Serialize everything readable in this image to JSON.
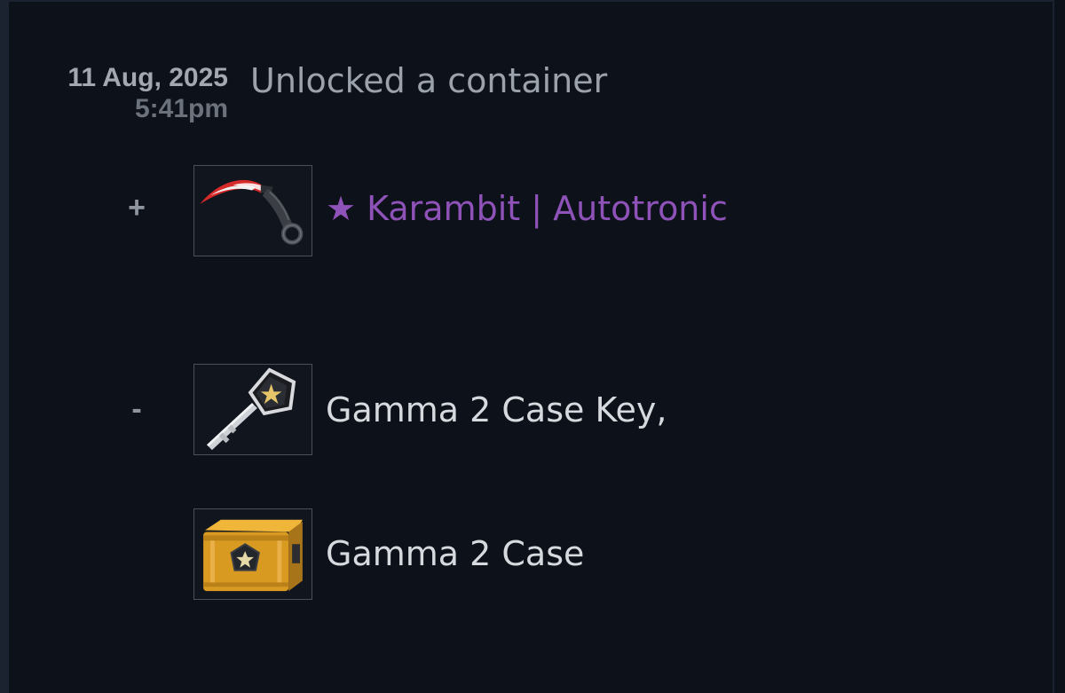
{
  "event": {
    "date": "11 Aug, 2025",
    "time": "5:41pm",
    "description": "Unlocked a container"
  },
  "gained": {
    "sign": "+",
    "items": [
      {
        "name": "★ Karambit | Autotronic",
        "icon": "karambit-knife-icon",
        "name_color": "#8e52b8"
      }
    ]
  },
  "lost": {
    "sign": "-",
    "items": [
      {
        "name": "Gamma 2 Case Key,",
        "icon": "case-key-icon"
      },
      {
        "name": "Gamma 2 Case",
        "icon": "weapon-case-icon"
      }
    ]
  }
}
